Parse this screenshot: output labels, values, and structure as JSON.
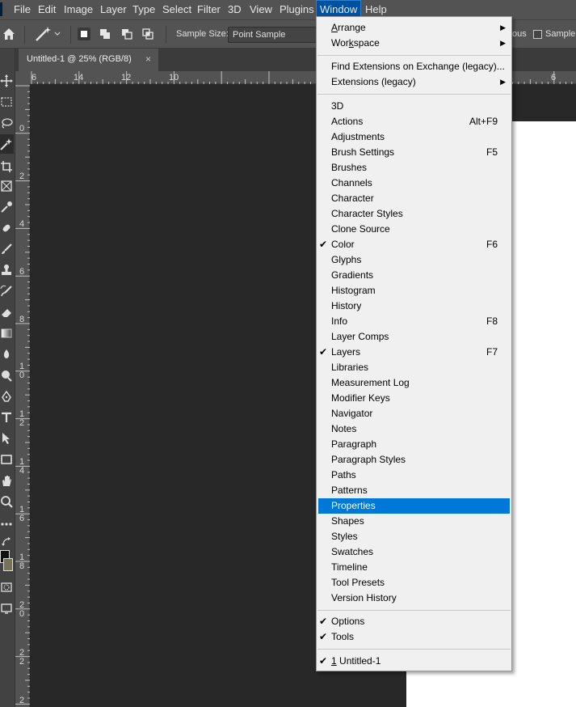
{
  "menubar": {
    "items": [
      {
        "label": "File"
      },
      {
        "label": "Edit"
      },
      {
        "label": "Image"
      },
      {
        "label": "Layer"
      },
      {
        "label": "Type"
      },
      {
        "label": "Select"
      },
      {
        "label": "Filter"
      },
      {
        "label": "3D"
      },
      {
        "label": "View"
      },
      {
        "label": "Plugins"
      },
      {
        "label": "Window"
      },
      {
        "label": "Help"
      }
    ]
  },
  "options": {
    "sample_size_label": "Sample Size:",
    "sample_size_value": "Point Sample",
    "contiguous_partial": "ous",
    "sample_all_partial": "Sample A"
  },
  "document": {
    "tab_title": "Untitled-1 @ 25% (RGB/8)",
    "close_glyph": "×"
  },
  "ruler": {
    "h_labels": [
      "6",
      "14",
      "12",
      "10",
      "6"
    ],
    "v_labels": [
      "0",
      "2",
      "4",
      "6",
      "8",
      "1\n0",
      "1\n2",
      "1\n4",
      "1\n6",
      "1\n8",
      "2\n0",
      "2\n2",
      "2"
    ]
  },
  "window_menu": {
    "arrange_pre": "",
    "arrange_u": "A",
    "arrange_post": "rrange",
    "workspace_pre": "Wor",
    "workspace_u": "k",
    "workspace_post": "space",
    "find_extensions": "Find Extensions on Exchange (legacy)...",
    "extensions": "Extensions (legacy)",
    "panels": [
      {
        "label": "3D",
        "shortcut": "",
        "checked": false
      },
      {
        "label": "Actions",
        "shortcut": "Alt+F9",
        "checked": false
      },
      {
        "label": "Adjustments",
        "shortcut": "",
        "checked": false
      },
      {
        "label": "Brush Settings",
        "shortcut": "F5",
        "checked": false
      },
      {
        "label": "Brushes",
        "shortcut": "",
        "checked": false
      },
      {
        "label": "Channels",
        "shortcut": "",
        "checked": false
      },
      {
        "label": "Character",
        "shortcut": "",
        "checked": false
      },
      {
        "label": "Character Styles",
        "shortcut": "",
        "checked": false
      },
      {
        "label": "Clone Source",
        "shortcut": "",
        "checked": false
      },
      {
        "label": "Color",
        "shortcut": "F6",
        "checked": true
      },
      {
        "label": "Glyphs",
        "shortcut": "",
        "checked": false
      },
      {
        "label": "Gradients",
        "shortcut": "",
        "checked": false
      },
      {
        "label": "Histogram",
        "shortcut": "",
        "checked": false
      },
      {
        "label": "History",
        "shortcut": "",
        "checked": false
      },
      {
        "label": "Info",
        "shortcut": "F8",
        "checked": false
      },
      {
        "label": "Layer Comps",
        "shortcut": "",
        "checked": false
      },
      {
        "label": "Layers",
        "shortcut": "F7",
        "checked": true
      },
      {
        "label": "Libraries",
        "shortcut": "",
        "checked": false
      },
      {
        "label": "Measurement Log",
        "shortcut": "",
        "checked": false
      },
      {
        "label": "Modifier Keys",
        "shortcut": "",
        "checked": false
      },
      {
        "label": "Navigator",
        "shortcut": "",
        "checked": false
      },
      {
        "label": "Notes",
        "shortcut": "",
        "checked": false
      },
      {
        "label": "Paragraph",
        "shortcut": "",
        "checked": false
      },
      {
        "label": "Paragraph Styles",
        "shortcut": "",
        "checked": false
      },
      {
        "label": "Paths",
        "shortcut": "",
        "checked": false
      },
      {
        "label": "Patterns",
        "shortcut": "",
        "checked": false
      },
      {
        "label": "Properties",
        "shortcut": "",
        "checked": false,
        "highlighted": true
      },
      {
        "label": "Shapes",
        "shortcut": "",
        "checked": false
      },
      {
        "label": "Styles",
        "shortcut": "",
        "checked": false
      },
      {
        "label": "Swatches",
        "shortcut": "",
        "checked": false
      },
      {
        "label": "Timeline",
        "shortcut": "",
        "checked": false
      },
      {
        "label": "Tool Presets",
        "shortcut": "",
        "checked": false
      },
      {
        "label": "Version History",
        "shortcut": "",
        "checked": false
      }
    ],
    "options_label": "Options",
    "tools_label": "Tools",
    "doc_number": "1",
    "doc_name": " Untitled-1",
    "check_glyph": "✔",
    "submenu_glyph": "▶"
  },
  "colors": {
    "menu_highlight": "#0078d7",
    "active_menu": "#0050a0",
    "panel_bg": "#535353",
    "canvas_bg": "#282828"
  }
}
